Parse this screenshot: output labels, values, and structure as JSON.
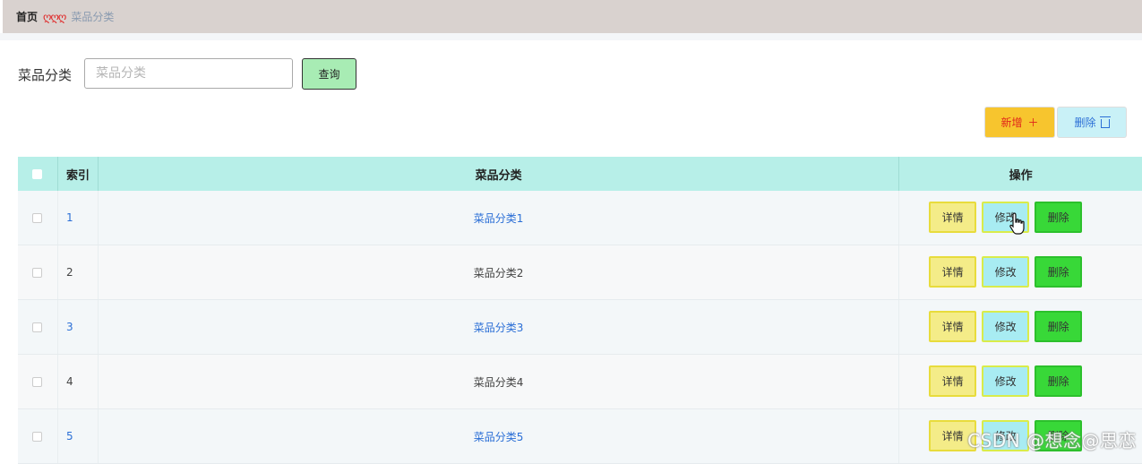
{
  "breadcrumb": {
    "home": "首页",
    "separator": "ღღღ",
    "current": "菜品分类"
  },
  "search": {
    "label": "菜品分类",
    "placeholder": "菜品分类",
    "value": "",
    "query_label": "查询"
  },
  "toolbar": {
    "add_label": "新增",
    "add_icon": "plus-icon",
    "delete_label": "删除",
    "delete_icon": "trash-icon"
  },
  "table": {
    "headers": {
      "index": "索引",
      "category": "菜品分类",
      "actions": "操作"
    },
    "rows": [
      {
        "index": "1",
        "category": "菜品分类1",
        "detail": "详情",
        "edit": "修改",
        "delete": "删除",
        "linked": true
      },
      {
        "index": "2",
        "category": "菜品分类2",
        "detail": "详情",
        "edit": "修改",
        "delete": "删除",
        "linked": false
      },
      {
        "index": "3",
        "category": "菜品分类3",
        "detail": "详情",
        "edit": "修改",
        "delete": "删除",
        "linked": true
      },
      {
        "index": "4",
        "category": "菜品分类4",
        "detail": "详情",
        "edit": "修改",
        "delete": "删除",
        "linked": false
      },
      {
        "index": "5",
        "category": "菜品分类5",
        "detail": "详情",
        "edit": "修改",
        "delete": "删除",
        "linked": true
      }
    ]
  },
  "watermark": "CSDN @想念@思恋",
  "colors": {
    "topbar": "#d9d2cf",
    "header_row": "#b7efe8",
    "query_button": "#a8ecb4",
    "add_button": "#f7c52e",
    "batch_delete_button": "#c9f1f7",
    "detail_button": "#f4ec88",
    "edit_button": "#a8ecf2",
    "delete_button": "#38d838",
    "link": "#2b6fd6"
  }
}
